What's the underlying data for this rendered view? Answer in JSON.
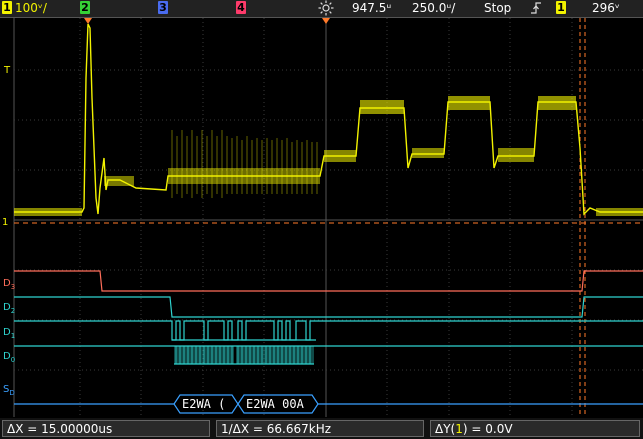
{
  "topbar": {
    "ch1": {
      "num": "1",
      "scale": "100ᵛ/",
      "color": "#f2f200"
    },
    "ch2": {
      "num": "2",
      "color": "#36d136"
    },
    "ch3": {
      "num": "3",
      "color": "#4a6cf0"
    },
    "ch4": {
      "num": "4",
      "color": "#ff3b6b"
    },
    "trigger_icon": "sun-trigger-icon",
    "delay": "947.5ᵘ",
    "timebase": "250.0ᵘ/",
    "run_state": "Stop",
    "edge_icon": "rising-edge-icon",
    "trig_src": "1",
    "trig_level": "296ᵛ"
  },
  "labels": {
    "trig_level_marker": "T",
    "ground_marker": "1",
    "d3": {
      "main": "D",
      "sub": "3"
    },
    "d2": {
      "main": "D",
      "sub": "2"
    },
    "d1": {
      "main": "D",
      "sub": "1"
    },
    "d0": {
      "main": "D",
      "sub": "0"
    },
    "s": {
      "main": "S",
      "sub": "D"
    }
  },
  "bus": {
    "seg1": "E2WA (",
    "seg2": "E2WA  00A"
  },
  "measurements": {
    "dx": "ΔX = 15.00000us",
    "inv_dx": "1/ΔX = 66.667kHz",
    "dy_prefix": "ΔY(",
    "dy_ch": "1",
    "dy_suffix": ") = 0.0V"
  },
  "colors": {
    "ch1": "#f2f200",
    "d3": "#ff6e5a",
    "digital": "#2fd3cf",
    "bus": "#3aa0ff",
    "cursor": "#ff7a2a",
    "grid": "#3a3a3a"
  }
}
